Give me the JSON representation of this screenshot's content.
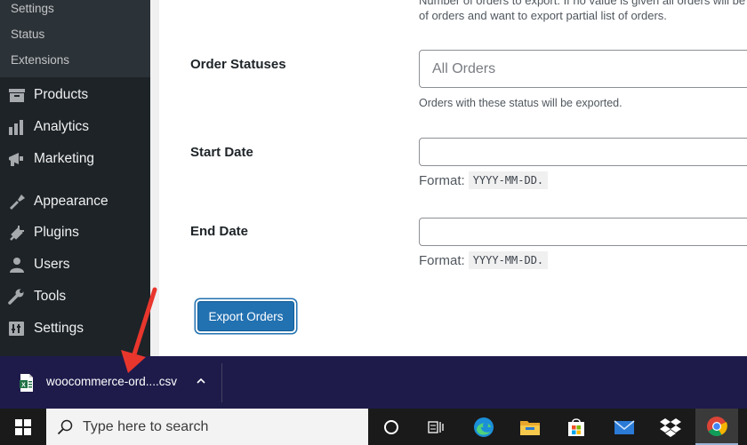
{
  "sidebar": {
    "submenu": [
      {
        "label": "Settings"
      },
      {
        "label": "Status"
      },
      {
        "label": "Extensions"
      }
    ],
    "menu": [
      {
        "label": "Products",
        "icon": "products-icon"
      },
      {
        "label": "Analytics",
        "icon": "analytics-icon"
      },
      {
        "label": "Marketing",
        "icon": "marketing-icon"
      },
      {
        "label": "Appearance",
        "icon": "appearance-icon"
      },
      {
        "label": "Plugins",
        "icon": "plugins-icon"
      },
      {
        "label": "Users",
        "icon": "users-icon"
      },
      {
        "label": "Tools",
        "icon": "tools-icon"
      },
      {
        "label": "Settings",
        "icon": "settings-icon"
      }
    ]
  },
  "form": {
    "top_description_line1": "Number of orders to export. If no value is given all orders will be ex",
    "top_description_line2": "of orders and want to export partial list of orders.",
    "order_statuses": {
      "label": "Order Statuses",
      "placeholder": "All Orders",
      "help": "Orders with these status will be exported."
    },
    "start_date": {
      "label": "Start Date",
      "value": "",
      "format_label": "Format:",
      "format_code": "YYYY-MM-DD."
    },
    "end_date": {
      "label": "End Date",
      "value": "",
      "format_label": "Format:",
      "format_code": "YYYY-MM-DD."
    },
    "export_button": "Export Orders"
  },
  "download_bar": {
    "file_name": "woocommerce-ord....csv",
    "file_icon": "excel-file-icon",
    "chevron_icon": "chevron-up-icon"
  },
  "taskbar": {
    "search_placeholder": "Type here to search",
    "apps": [
      "cortana-icon",
      "task-view-icon",
      "edge-icon",
      "file-explorer-icon",
      "store-icon",
      "mail-icon",
      "dropbox-icon",
      "chrome-icon"
    ]
  },
  "colors": {
    "sidebar_bg": "#1d2327",
    "button_primary": "#2271b1",
    "download_bar_bg": "#1e1b4b",
    "annotation_arrow": "#e8362d"
  }
}
